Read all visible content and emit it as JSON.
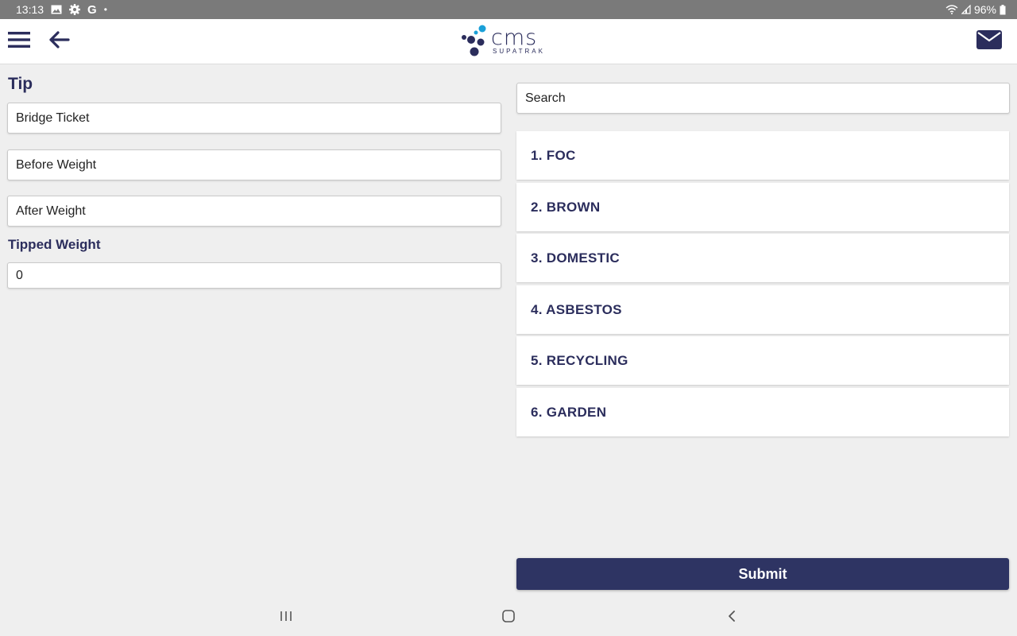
{
  "status_bar": {
    "time": "13:13",
    "left_icons": [
      "image-icon",
      "settings-icon",
      "google-icon",
      "dot-icon"
    ],
    "right_icons": [
      "wifi-icon",
      "signal-icon",
      "battery-icon"
    ],
    "battery": "96%"
  },
  "app_bar": {
    "logo_text": "cms",
    "logo_subtext": "SUPATRAK",
    "brand_color": "#2b2d5c",
    "accent_color": "#1aa0d8"
  },
  "form": {
    "title": "Tip",
    "bridge_ticket_placeholder": "Bridge Ticket",
    "before_weight_placeholder": "Before Weight",
    "after_weight_placeholder": "After Weight",
    "tipped_weight_label": "Tipped Weight",
    "tipped_weight_value": "0"
  },
  "search": {
    "placeholder": "Search"
  },
  "waste_types": [
    {
      "label": "1. FOC"
    },
    {
      "label": "2. BROWN"
    },
    {
      "label": "3. DOMESTIC"
    },
    {
      "label": "4. ASBESTOS"
    },
    {
      "label": "5. RECYCLING"
    },
    {
      "label": "6. GARDEN"
    }
  ],
  "submit_label": "Submit",
  "submit_color": "#2e3463",
  "nav_bar": {
    "buttons": [
      "recent-apps-icon",
      "home-icon",
      "back-icon"
    ]
  }
}
